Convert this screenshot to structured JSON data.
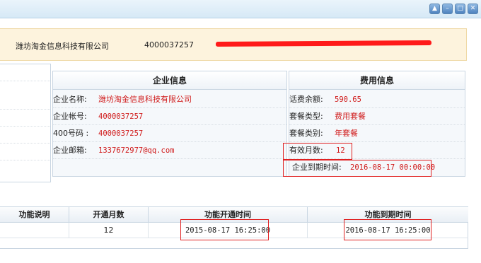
{
  "window": {
    "buttons": [
      "▲",
      "–",
      "□",
      "✕"
    ]
  },
  "client": {
    "company": "潍坊淘金信息科技有限公司",
    "account": "4000037257"
  },
  "company_panel": {
    "title": "企业信息",
    "rows": [
      {
        "label": "企业名称:",
        "value": "潍坊淘金信息科技有限公司"
      },
      {
        "label": "企业帐号:",
        "value": "4000037257"
      },
      {
        "label": "400号码 :",
        "value": "4000037257"
      },
      {
        "label": "企业邮箱:",
        "value": "1337672977@qq.com"
      }
    ]
  },
  "cost_panel": {
    "title": "费用信息",
    "rows": [
      {
        "label": "话费余额:",
        "value": "590.65"
      },
      {
        "label": "套餐类型:",
        "value": "费用套餐"
      },
      {
        "label": "套餐类别:",
        "value": "年套餐"
      },
      {
        "label": "有效月数:",
        "value": "12"
      },
      {
        "label": "企业到期时间:",
        "value": "2016-08-17 00:00:00"
      }
    ]
  },
  "function_table": {
    "headers": [
      "功能说明",
      "开通月数",
      "功能开通时间",
      "功能到期时间"
    ],
    "rows": [
      [
        "",
        "12",
        "2015-08-17 16:25:00",
        "2016-08-17 16:25:00"
      ]
    ]
  }
}
